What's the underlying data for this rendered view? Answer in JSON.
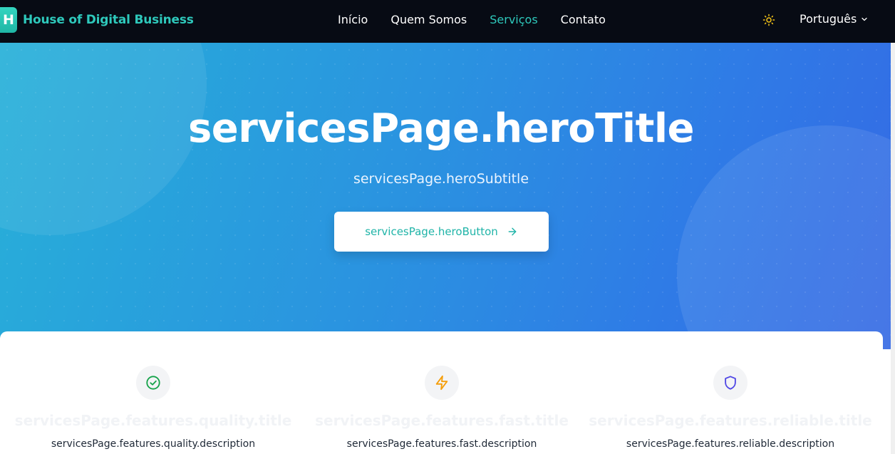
{
  "brand": {
    "logo_letter": "H",
    "name": "House of Digital Business"
  },
  "nav": {
    "items": [
      {
        "label": "Início"
      },
      {
        "label": "Quem Somos"
      },
      {
        "label": "Serviços",
        "active": true
      },
      {
        "label": "Contato"
      }
    ],
    "theme_icon": "sun-icon",
    "language": "Português"
  },
  "hero": {
    "title": "servicesPage.heroTitle",
    "subtitle": "servicesPage.heroSubtitle",
    "button_label": "servicesPage.heroButton",
    "button_icon": "arrow-right-icon"
  },
  "features": [
    {
      "icon": "check-circle-icon",
      "icon_color": "#16a34a",
      "title": "servicesPage.features.quality.title",
      "description": "servicesPage.features.quality.description"
    },
    {
      "icon": "lightning-bolt-icon",
      "icon_color": "#f59e0b",
      "title": "servicesPage.features.fast.title",
      "description": "servicesPage.features.fast.description"
    },
    {
      "icon": "shield-icon",
      "icon_color": "#4f46e5",
      "title": "servicesPage.features.reliable.title",
      "description": "servicesPage.features.reliable.description"
    }
  ],
  "colors": {
    "accent": "#2ec9bc",
    "nav_bg": "#070b14",
    "hero_start": "#27b0d8",
    "hero_end": "#3569e4"
  }
}
